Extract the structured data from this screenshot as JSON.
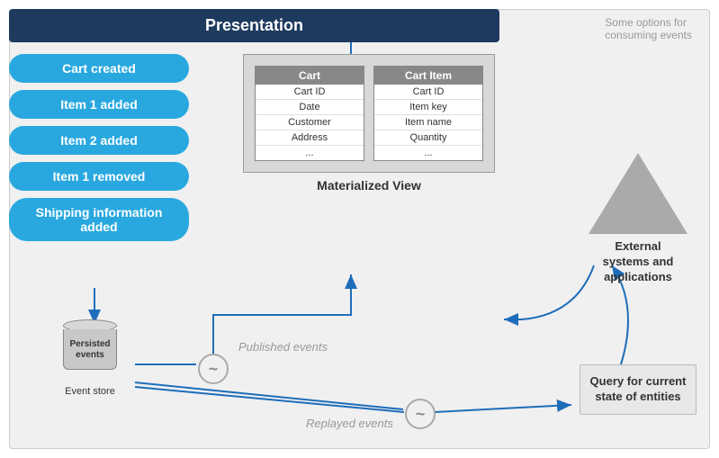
{
  "header": {
    "title": "Presentation"
  },
  "events": [
    {
      "label": "Cart created"
    },
    {
      "label": "Item 1 added"
    },
    {
      "label": "Item 2 added"
    },
    {
      "label": "Item 1 removed"
    },
    {
      "label": "Shipping information added"
    }
  ],
  "eventStore": {
    "label": "Persisted\nevents",
    "sublabel": "Event store"
  },
  "tildes": {
    "published": "~",
    "replayed": "~"
  },
  "publishedLabel": "Published events",
  "replayedLabel": "Replayed events",
  "matView": {
    "title": "Materialized View",
    "cart": {
      "header": "Cart",
      "rows": [
        "Cart ID",
        "Date",
        "Customer",
        "Address",
        "..."
      ]
    },
    "cartItem": {
      "header": "Cart Item",
      "rows": [
        "Cart ID",
        "Item key",
        "Item name",
        "Quantity",
        "..."
      ]
    }
  },
  "someOptions": "Some options for\nconsuming events",
  "external": {
    "label": "External\nsystems and\napplications"
  },
  "query": {
    "label": "Query for\ncurrent state\nof entities"
  }
}
